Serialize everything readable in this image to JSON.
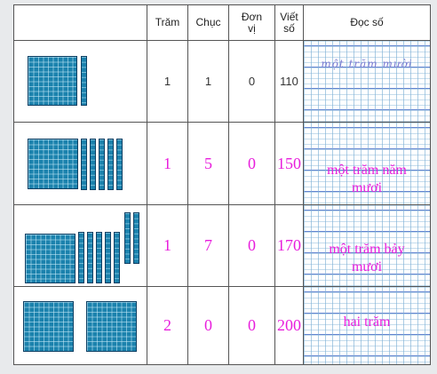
{
  "headers": {
    "tram": "Trăm",
    "chuc": "Chục",
    "don_vi": "Đơn vị",
    "viet_so": "Viết số",
    "doc_so": "Đọc số"
  },
  "rows": [
    {
      "hundreds_blocks": 1,
      "tens_rods": 1,
      "tram": "1",
      "chuc": "1",
      "don_vi": "0",
      "viet_so": "110",
      "doc_so": "một trăm mười",
      "style": "printed"
    },
    {
      "hundreds_blocks": 1,
      "tens_rods": 5,
      "tram": "1",
      "chuc": "5",
      "don_vi": "0",
      "viet_so": "150",
      "doc_so": "một trăm năm mươi",
      "style": "handwritten"
    },
    {
      "hundreds_blocks": 1,
      "tens_rods": 7,
      "tram": "1",
      "chuc": "7",
      "don_vi": "0",
      "viet_so": "170",
      "doc_so": "một trăm bảy mươi",
      "style": "handwritten"
    },
    {
      "hundreds_blocks": 2,
      "tens_rods": 0,
      "tram": "2",
      "chuc": "0",
      "don_vi": "0",
      "viet_so": "200",
      "doc_so": "hai trăm",
      "style": "handwritten"
    }
  ],
  "colors": {
    "block": "#1b82ad",
    "handwriting": "#e81ddc"
  }
}
